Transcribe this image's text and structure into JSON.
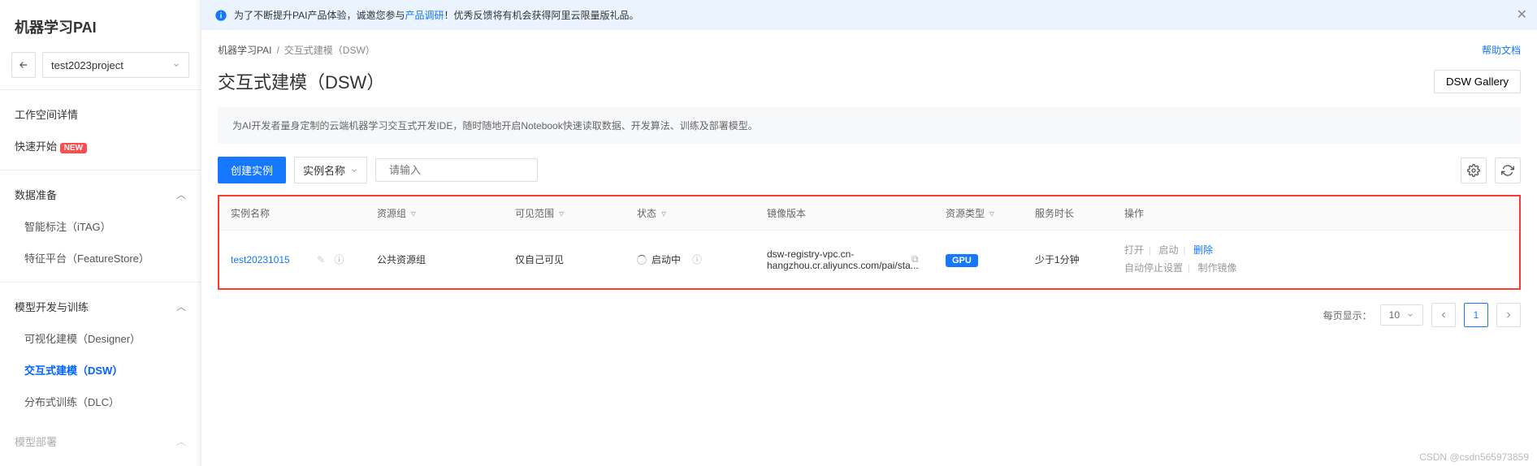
{
  "logo": "机器学习PAI",
  "project": {
    "name": "test2023project"
  },
  "sidebar": {
    "workspace_detail": "工作空间详情",
    "quick_start": "快速开始",
    "quick_start_badge": "NEW",
    "groups": [
      {
        "title": "数据准备",
        "items": [
          {
            "label": "智能标注（iTAG）",
            "active": false
          },
          {
            "label": "特征平台（FeatureStore）",
            "active": false
          }
        ]
      },
      {
        "title": "模型开发与训练",
        "items": [
          {
            "label": "可视化建模（Designer）",
            "active": false
          },
          {
            "label": "交互式建模（DSW）",
            "active": true
          },
          {
            "label": "分布式训练（DLC）",
            "active": false
          }
        ]
      }
    ],
    "partial_group": "模型部署"
  },
  "banner": {
    "prefix": "为了不断提升PAI产品体验，诚邀您参与",
    "link": "产品调研",
    "suffix": "！优秀反馈将有机会获得阿里云限量版礼品。"
  },
  "breadcrumb": {
    "root": "机器学习PAI",
    "current": "交互式建模（DSW）",
    "help": "帮助文档"
  },
  "page_title": "交互式建模（DSW）",
  "gallery_btn": "DSW Gallery",
  "description": "为AI开发者量身定制的云端机器学习交互式开发IDE，随时随地开启Notebook快速读取数据、开发算法、训练及部署模型。",
  "toolbar": {
    "create": "创建实例",
    "filter_by": "实例名称",
    "search_placeholder": "请输入"
  },
  "table": {
    "headers": {
      "name": "实例名称",
      "resource_group": "资源组",
      "visibility": "可见范围",
      "status": "状态",
      "image": "镜像版本",
      "resource_type": "资源类型",
      "runtime": "服务时长",
      "ops": "操作"
    },
    "row": {
      "name": "test20231015",
      "resource_group": "公共资源组",
      "visibility": "仅自己可见",
      "status": "启动中",
      "image": "dsw-registry-vpc.cn-hangzhou.cr.aliyuncs.com/pai/sta...",
      "resource_type": "GPU",
      "runtime": "少于1分钟",
      "ops": {
        "open": "打开",
        "start": "启动",
        "delete": "删除",
        "auto_stop": "自动停止设置",
        "make_image": "制作镜像"
      }
    }
  },
  "pager": {
    "label": "每页显示：",
    "size": "10",
    "current": "1"
  },
  "watermark": "CSDN @csdn565973859"
}
